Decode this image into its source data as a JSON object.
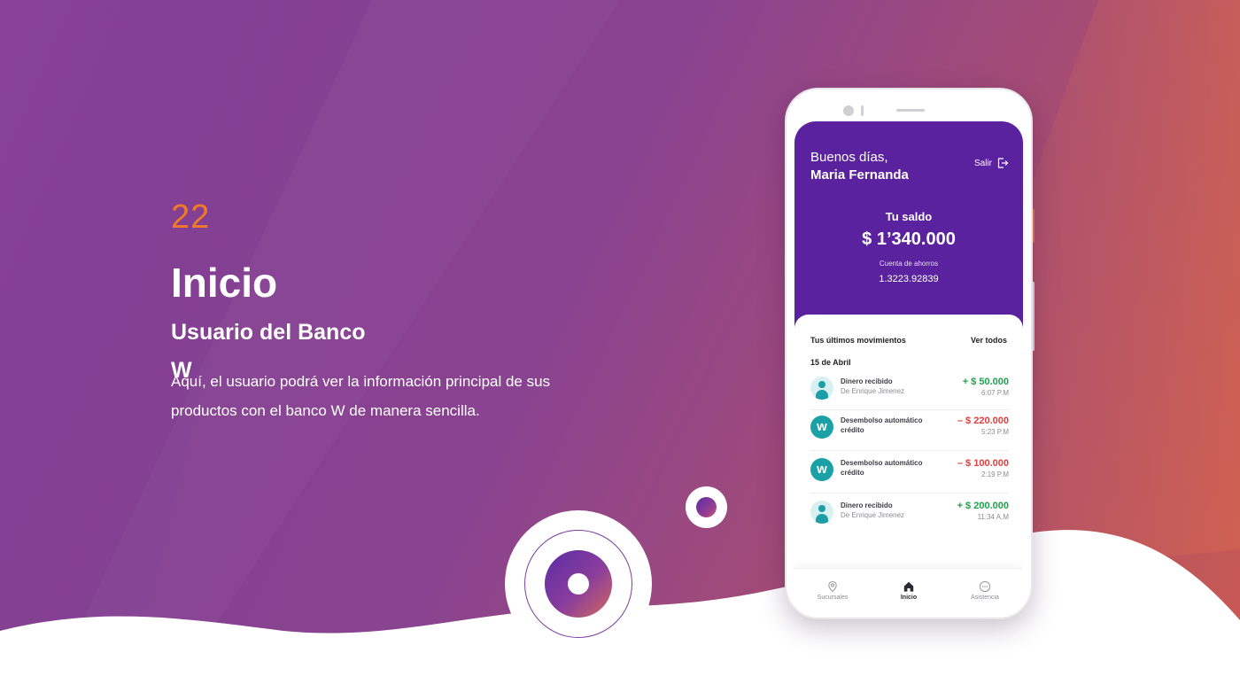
{
  "slide": {
    "number": "22",
    "title": "Inicio",
    "subtitle": "Usuario del Banco W",
    "description": "Aquí, el usuario podrá ver la información principal de sus productos con el banco W de manera sencilla."
  },
  "colors": {
    "accent_orange": "#f07a2a",
    "app_purple": "#5b22a0",
    "positive_green": "#1fa34d",
    "negative_red": "#e43d3d",
    "brand_teal": "#1aa0a5"
  },
  "app": {
    "header": {
      "greeting": "Buenos días,",
      "user_name": "Maria Fernanda",
      "logout_label": "Salir",
      "logout_icon": "logout-icon"
    },
    "balance": {
      "label": "Tu saldo",
      "amount": "$ 1’340.000",
      "account_type": "Cuenta de ahorros",
      "account_number": "1.3223.92839"
    },
    "movements": {
      "title": "Tus últimos movimientos",
      "view_all": "Ver todos",
      "date": "15 de Abril",
      "items": [
        {
          "title": "Dinero recibido",
          "subtitle": "De Enrique Jimenez",
          "amount": "+ $ 50.000",
          "time": "6:07 P.M",
          "kind": "positive",
          "avatar": "person-icon"
        },
        {
          "title": "Desembolso automático crédito",
          "subtitle": "",
          "amount": "– $ 220.000",
          "time": "5:23 P.M",
          "kind": "negative",
          "avatar": "bank-w-logo"
        },
        {
          "title": "Desembolso automático crédito",
          "subtitle": "",
          "amount": "– $ 100.000",
          "time": "2:19 P.M",
          "kind": "negative",
          "avatar": "bank-w-logo"
        },
        {
          "title": "Dinero recibido",
          "subtitle": "De Enrique Jimenez",
          "amount": "+ $ 200.000",
          "time": "11:34 A.M",
          "kind": "positive",
          "avatar": "person-icon"
        }
      ]
    },
    "nav": [
      {
        "label": "Sucursales",
        "icon": "location-pin-icon",
        "active": false
      },
      {
        "label": "Inicio",
        "icon": "home-icon",
        "active": true
      },
      {
        "label": "Asistencia",
        "icon": "chat-icon",
        "active": false
      }
    ],
    "brand_letter": "w"
  }
}
